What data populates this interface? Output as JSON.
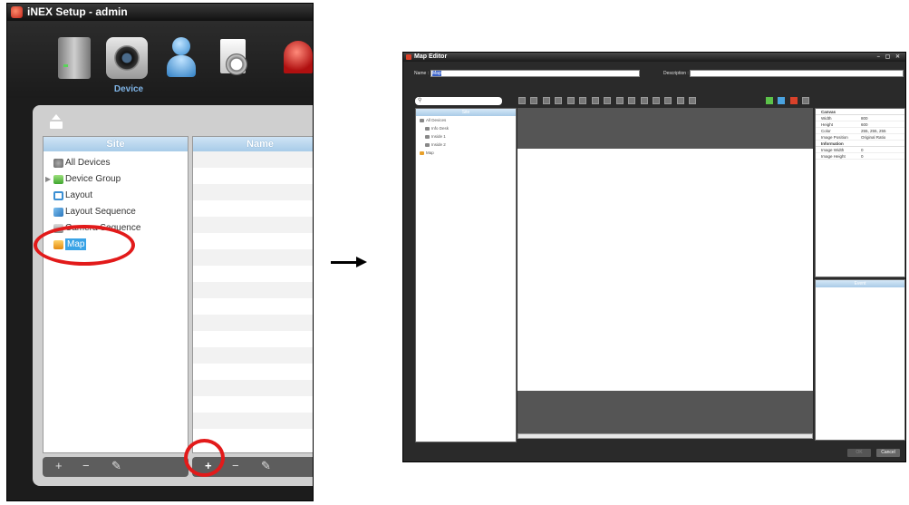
{
  "inex_window": {
    "title": "iNEX Setup - admin",
    "toolbar": {
      "icons": [
        "server-icon",
        "device-icon",
        "user-icon",
        "schedule-icon",
        "alarm-icon"
      ],
      "active_label": "Device"
    },
    "site_pane": {
      "header": "Site",
      "items": [
        {
          "label": "All Devices",
          "icon": "all-devices-icon"
        },
        {
          "label": "Device Group",
          "icon": "device-group-icon",
          "expandable": true
        },
        {
          "label": "Layout",
          "icon": "layout-icon"
        },
        {
          "label": "Layout Sequence",
          "icon": "layout-sequence-icon"
        },
        {
          "label": "Camera Sequence",
          "icon": "camera-sequence-icon"
        },
        {
          "label": "Map",
          "icon": "map-icon",
          "selected": true
        }
      ]
    },
    "name_pane": {
      "header": "Name"
    },
    "footer_left": {
      "add": "+",
      "remove": "−",
      "edit": "✎"
    },
    "footer_right": {
      "add": "+",
      "remove": "−",
      "edit": "✎"
    }
  },
  "map_editor": {
    "title": "Map Editor",
    "window_buttons": "– ▢ ✕",
    "name_label": "Name :",
    "name_value": "Map",
    "description_label": "Description :",
    "description_value": "",
    "search_placeholder": "",
    "site_header": "Site",
    "site_items": [
      {
        "label": "All Devices"
      },
      {
        "label": "Info Desk"
      },
      {
        "label": "Inside 1"
      },
      {
        "label": "Inside 2"
      },
      {
        "label": "Map"
      }
    ],
    "properties": {
      "canvas_header": "Canvas",
      "canvas_rows": [
        {
          "key": "Width",
          "value": "800"
        },
        {
          "key": "Height",
          "value": "600"
        },
        {
          "key": "Color",
          "value": "255, 255, 255"
        },
        {
          "key": "Image Position",
          "value": "Original Ratio"
        }
      ],
      "info_header": "Information",
      "info_rows": [
        {
          "key": "Image Width",
          "value": "0"
        },
        {
          "key": "Image Height",
          "value": "0"
        }
      ]
    },
    "event_header": "Event",
    "ok_button": "OK",
    "cancel_button": "Cancel"
  },
  "colors": {
    "highlight": "#e21a1a",
    "selection": "#3aa3e6",
    "header_blue": "#a7cbe8"
  }
}
